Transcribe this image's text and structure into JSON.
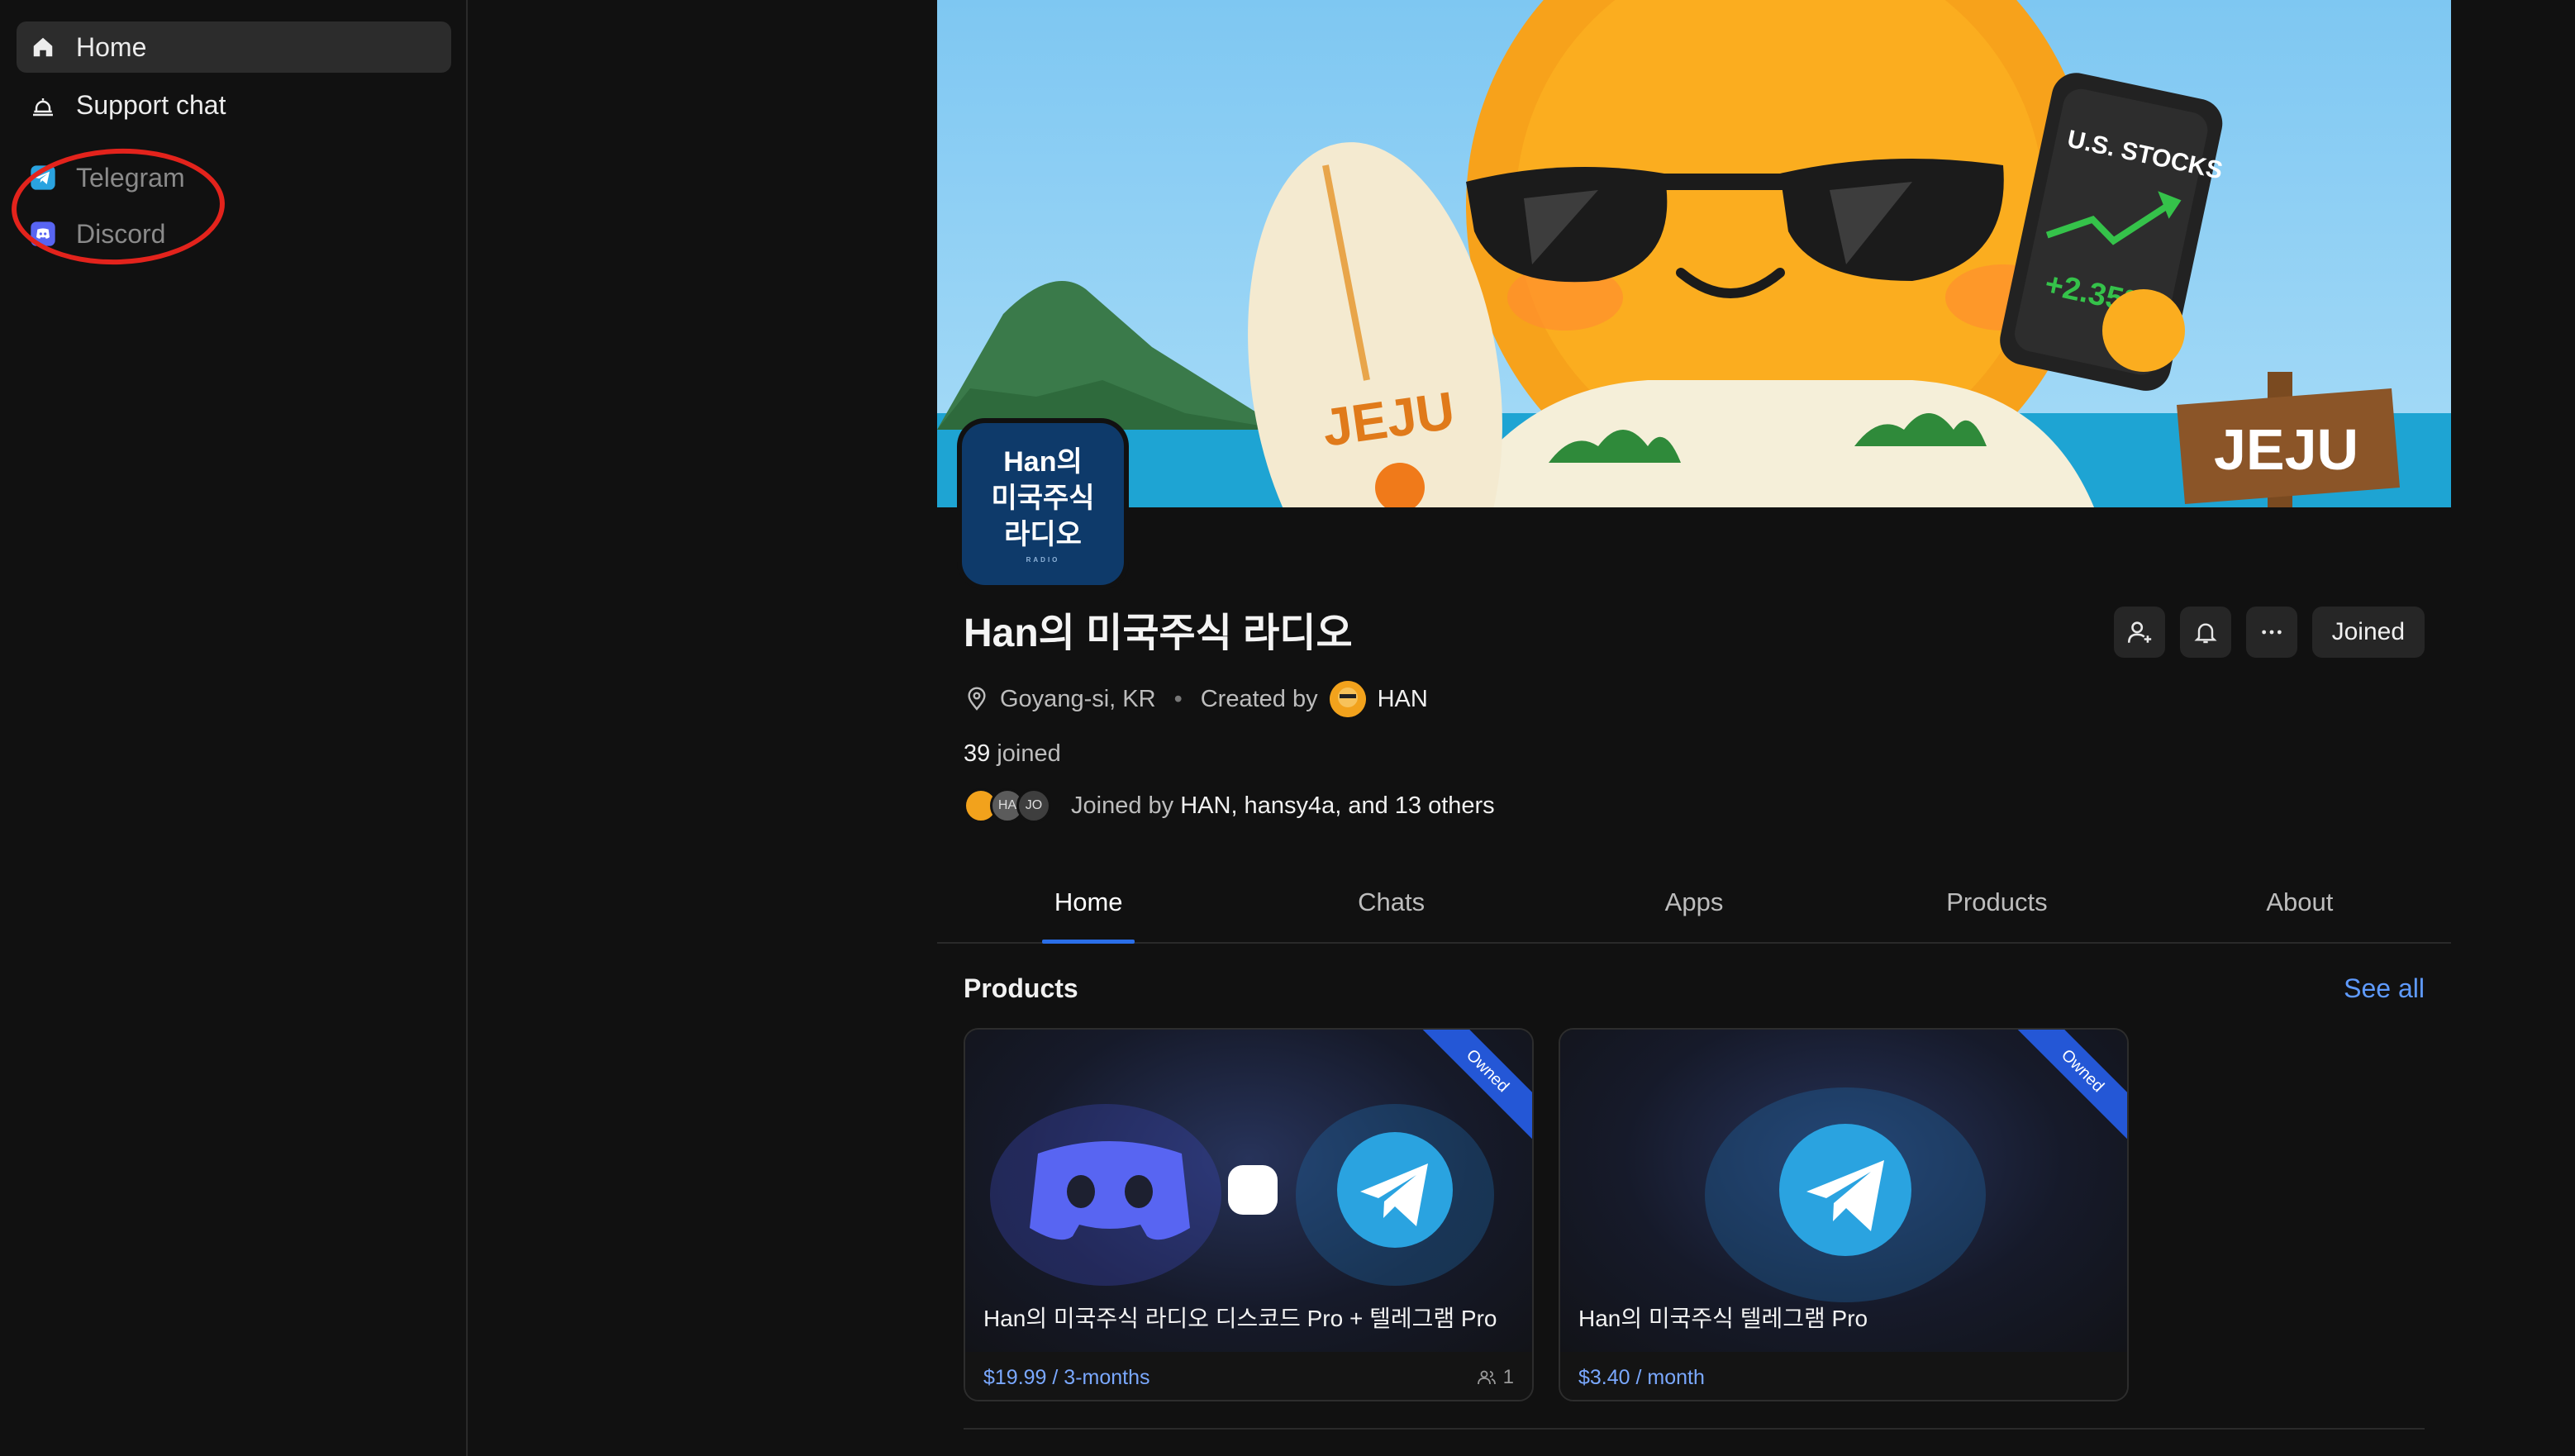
{
  "sidebar": {
    "items": [
      {
        "label": "Home",
        "icon": "home-icon"
      },
      {
        "label": "Support chat",
        "icon": "bell-icon"
      },
      {
        "label": "Telegram",
        "icon": "telegram-icon"
      },
      {
        "label": "Discord",
        "icon": "discord-icon"
      }
    ]
  },
  "banner": {
    "phone_title": "U.S. STOCKS",
    "phone_change": "+2.35%",
    "surfboard_text": "JEJU",
    "sign_text": "JEJU"
  },
  "group": {
    "avatar_lines": [
      "Han의",
      "미국주식",
      "라디오"
    ],
    "avatar_small": "RADIO",
    "title": "Han의 미국주식 라디오",
    "location": "Goyang-si, KR",
    "created_by_label": "Created by",
    "creator": "HAN",
    "joined_count": "39",
    "joined_label": "joined",
    "member_initials": [
      "",
      "HA",
      "JO"
    ],
    "joined_by_prefix": "Joined by",
    "joined_by_names": "HAN, hansy4a,",
    "joined_by_suffix": "and 13 others"
  },
  "actions": {
    "joined_label": "Joined"
  },
  "tabs": [
    "Home",
    "Chats",
    "Apps",
    "Products",
    "About"
  ],
  "products_section": {
    "title": "Products",
    "see_all": "See all",
    "cards": [
      {
        "title": "Han의 미국주식 라디오 디스코드 Pro + 텔레그램 Pro",
        "price": "$19.99 / 3-months",
        "members": "1",
        "badge": "Owned"
      },
      {
        "title": "Han의 미국주식 텔레그램 Pro",
        "price": "$3.40 / month",
        "badge": "Owned"
      }
    ]
  },
  "colors": {
    "accent": "#2a6ee8",
    "link": "#5f9bff",
    "annotation": "#e3231c"
  }
}
